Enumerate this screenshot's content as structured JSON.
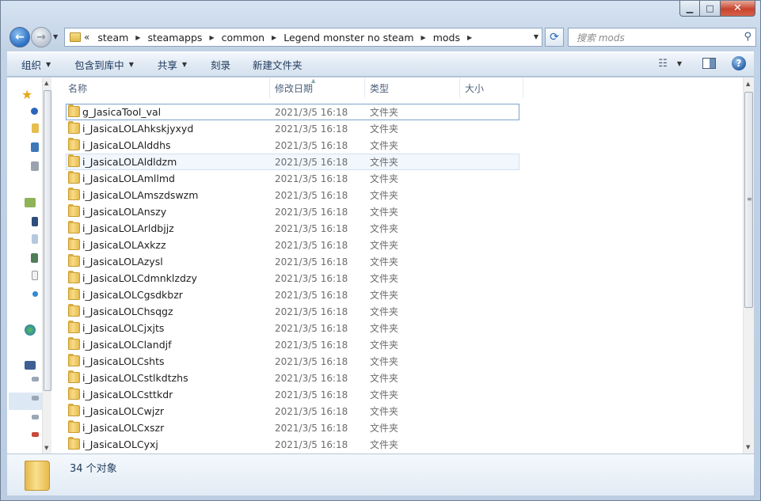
{
  "window": {
    "caption": {
      "minimize": "▁",
      "maximize": "□",
      "close": "✕"
    }
  },
  "nav": {
    "back_glyph": "←",
    "forward_glyph": "→",
    "overflow": "«",
    "breadcrumbs": [
      "steam",
      "steamapps",
      "common",
      "Legend monster no steam",
      "mods"
    ],
    "refresh_glyph": "⟳",
    "search_placeholder": "搜索 mods",
    "search_icon": "magnifier-icon"
  },
  "toolbar": {
    "organize": "组织",
    "include_in_library": "包含到库中",
    "share": "共享",
    "burn": "刻录",
    "new_folder": "新建文件夹",
    "help": "?"
  },
  "columns": {
    "name": "名称",
    "date": "修改日期",
    "type": "类型",
    "size": "大小"
  },
  "files": [
    {
      "name": "g_JasicaTool_val",
      "date": "2021/3/5 16:18",
      "type": "文件夹"
    },
    {
      "name": "i_JasicaLOLAhkskjyxyd",
      "date": "2021/3/5 16:18",
      "type": "文件夹"
    },
    {
      "name": "i_JasicaLOLAlddhs",
      "date": "2021/3/5 16:18",
      "type": "文件夹"
    },
    {
      "name": "i_JasicaLOLAldldzm",
      "date": "2021/3/5 16:18",
      "type": "文件夹"
    },
    {
      "name": "i_JasicaLOLAmllmd",
      "date": "2021/3/5 16:18",
      "type": "文件夹"
    },
    {
      "name": "i_JasicaLOLAmszdswzm",
      "date": "2021/3/5 16:18",
      "type": "文件夹"
    },
    {
      "name": "i_JasicaLOLAnszy",
      "date": "2021/3/5 16:18",
      "type": "文件夹"
    },
    {
      "name": "i_JasicaLOLArldbjjz",
      "date": "2021/3/5 16:18",
      "type": "文件夹"
    },
    {
      "name": "i_JasicaLOLAxkzz",
      "date": "2021/3/5 16:18",
      "type": "文件夹"
    },
    {
      "name": "i_JasicaLOLAzysl",
      "date": "2021/3/5 16:18",
      "type": "文件夹"
    },
    {
      "name": "i_JasicaLOLCdmnklzdzy",
      "date": "2021/3/5 16:18",
      "type": "文件夹"
    },
    {
      "name": "i_JasicaLOLCgsdkbzr",
      "date": "2021/3/5 16:18",
      "type": "文件夹"
    },
    {
      "name": "i_JasicaLOLChsqgz",
      "date": "2021/3/5 16:18",
      "type": "文件夹"
    },
    {
      "name": "i_JasicaLOLCjxjts",
      "date": "2021/3/5 16:18",
      "type": "文件夹"
    },
    {
      "name": "i_JasicaLOLClandjf",
      "date": "2021/3/5 16:18",
      "type": "文件夹"
    },
    {
      "name": "i_JasicaLOLCshts",
      "date": "2021/3/5 16:18",
      "type": "文件夹"
    },
    {
      "name": "i_JasicaLOLCstlkdtzhs",
      "date": "2021/3/5 16:18",
      "type": "文件夹"
    },
    {
      "name": "i_JasicaLOLCsttkdr",
      "date": "2021/3/5 16:18",
      "type": "文件夹"
    },
    {
      "name": "i_JasicaLOLCwjzr",
      "date": "2021/3/5 16:18",
      "type": "文件夹"
    },
    {
      "name": "i_JasicaLOLCxszr",
      "date": "2021/3/5 16:18",
      "type": "文件夹"
    },
    {
      "name": "i_JasicaLOLCyxj",
      "date": "2021/3/5 16:18",
      "type": "文件夹"
    }
  ],
  "status": {
    "count_text": "34 个对象"
  },
  "colors": {
    "accent": "#2a6fc4",
    "close": "#c7452e",
    "folder": "#f7dc86"
  }
}
